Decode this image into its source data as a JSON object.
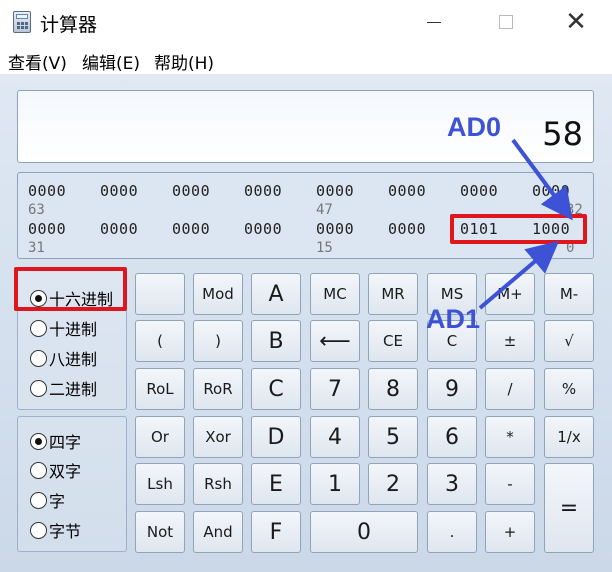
{
  "window": {
    "title": "计算器",
    "minimize": "",
    "maximize": "",
    "close": "✕"
  },
  "menu": [
    {
      "label": "查看(V)"
    },
    {
      "label": "编辑(E)"
    },
    {
      "label": "帮助(H)"
    }
  ],
  "display": {
    "value": "58"
  },
  "bits": {
    "row1": [
      "0000",
      "0000",
      "0000",
      "0000",
      "0000",
      "0000",
      "0000",
      "0000"
    ],
    "row1_labels": [
      "63",
      "47",
      "32"
    ],
    "row2": [
      "0000",
      "0000",
      "0000",
      "0000",
      "0000",
      "0000",
      "0101",
      "1000"
    ],
    "row2_labels": [
      "31",
      "15",
      "0"
    ]
  },
  "base_modes": [
    {
      "label": "十六进制",
      "checked": true
    },
    {
      "label": "十进制",
      "checked": false
    },
    {
      "label": "八进制",
      "checked": false
    },
    {
      "label": "二进制",
      "checked": false
    }
  ],
  "word_sizes": [
    {
      "label": "四字",
      "checked": true
    },
    {
      "label": "双字",
      "checked": false
    },
    {
      "label": "字",
      "checked": false
    },
    {
      "label": "字节",
      "checked": false
    }
  ],
  "keys": {
    "blank": "",
    "mod": "Mod",
    "a": "A",
    "mc": "MC",
    "mr": "MR",
    "ms": "MS",
    "mplus": "M+",
    "mminus": "M-",
    "lparen": "(",
    "rparen": ")",
    "b": "B",
    "backspace": "⟵",
    "ce": "CE",
    "c": "C",
    "plusminus": "±",
    "sqrt": "√",
    "rol": "RoL",
    "ror": "RoR",
    "c_hex": "C",
    "n7": "7",
    "n8": "8",
    "n9": "9",
    "divide": "/",
    "percent": "%",
    "or": "Or",
    "xor": "Xor",
    "d": "D",
    "n4": "4",
    "n5": "5",
    "n6": "6",
    "multiply": "*",
    "reciprocal": "1/x",
    "lsh": "Lsh",
    "rsh": "Rsh",
    "e": "E",
    "n1": "1",
    "n2": "2",
    "n3": "3",
    "minus": "-",
    "equals": "=",
    "not": "Not",
    "and": "And",
    "f": "F",
    "n0": "0",
    "dot": ".",
    "plus": "+"
  },
  "annotations": {
    "ad0": "AD0",
    "ad1": "AD1"
  },
  "colors": {
    "highlight": "#e0161f",
    "annotation": "#3d52d5"
  }
}
